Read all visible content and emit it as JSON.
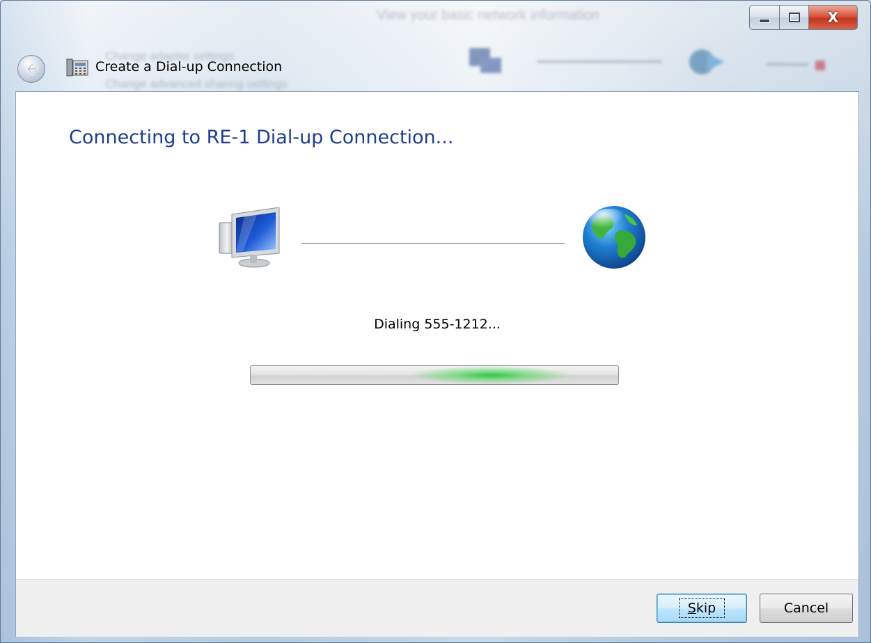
{
  "window": {
    "title": "Create a Dial-up Connection",
    "caption_buttons": {
      "minimize_icon": "minimize-icon",
      "maximize_icon": "maximize-icon",
      "close_label": "X"
    }
  },
  "background": {
    "blurred_text_1": "View your basic network information",
    "blurred_text_2": "Change adapter settings",
    "blurred_text_3": "Change advanced sharing settings"
  },
  "main": {
    "heading": "Connecting to RE-1 Dial-up Connection...",
    "status": "Dialing 555-1212...",
    "progress": {
      "state": "indeterminate",
      "color": "#22c43a"
    },
    "icons": {
      "left": "computer-icon",
      "right": "globe-icon"
    }
  },
  "footer": {
    "skip_label_mnemonic": "S",
    "skip_label_rest": "kip",
    "cancel_label": "Cancel"
  },
  "colors": {
    "heading": "#1e3e8a",
    "close_button": "#c4351d",
    "progress_glow": "#22c43a"
  }
}
